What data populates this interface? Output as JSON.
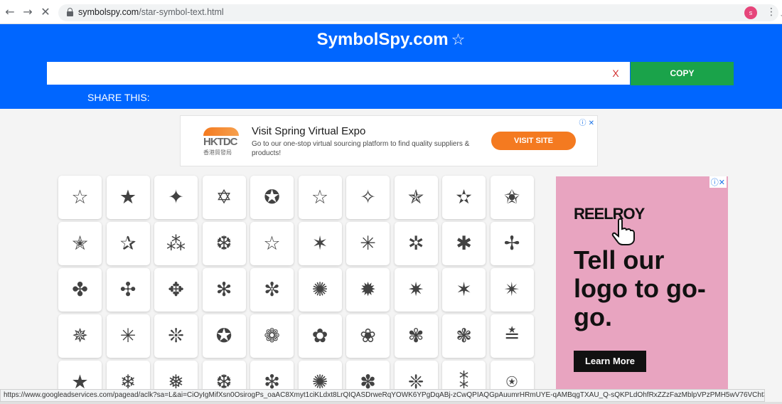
{
  "browser": {
    "url_domain": "symbolspy.com",
    "url_path": "/star-symbol-text.html",
    "profile_initial": "s"
  },
  "header": {
    "logo": "SymbolSpy.com",
    "logo_star": "☆",
    "input_value": "",
    "clear_label": "X",
    "copy_label": "COPY",
    "share_label": "SHARE THIS:",
    "brand_color": "#0066ff",
    "copy_color": "#1aa34a"
  },
  "top_ad": {
    "brand_text": "HKTDC",
    "brand_sub": "香港貿發局",
    "title": "Visit Spring Virtual Expo",
    "description": "Go to our one-stop virtual sourcing platform to find quality suppliers & products!",
    "button": "VISIT SITE",
    "info_icons": "ⓘ ✕"
  },
  "symbols": [
    [
      "☆",
      "★",
      "✦",
      "✡",
      "✪",
      "☆",
      "✧",
      "✯",
      "✫",
      "✬"
    ],
    [
      "✭",
      "✰",
      "⁂",
      "❆",
      "☆",
      "✶",
      "✳",
      "✲",
      "✱",
      "✢"
    ],
    [
      "✤",
      "✣",
      "✥",
      "✻",
      "✼",
      "✺",
      "✹",
      "✷",
      "✶",
      "✴"
    ],
    [
      "✵",
      "✳",
      "❊",
      "✪",
      "❁",
      "✿",
      "❀",
      "✾",
      "❃",
      "≛"
    ],
    [
      "★",
      "❄",
      "❅",
      "❆",
      "❇",
      "✺",
      "✽",
      "❈",
      "⁑",
      "⍟"
    ]
  ],
  "side_ad": {
    "brand": "REELROY",
    "headline": "Tell our logo to go-go.",
    "button": "Learn More",
    "info_icons": "ⓘ✕",
    "bg_color": "#e8a4c0"
  },
  "status_bar": {
    "text": "https://www.googleadservices.com/pagead/aclk?sa=L&ai=CiOyIgMifXsn0OsirogPs_oaAC8Xmyt1ciKLdxt8LrQIQASDrweRqYOWK6YPgDqABj-zCwQPIAQGpAuumrHRmUYE-qAMBqgTXAU_Q-sQKPLdOhfRxZZzFazMblpVPzPMH5wV76VCht3u8f84bR23a..."
  }
}
